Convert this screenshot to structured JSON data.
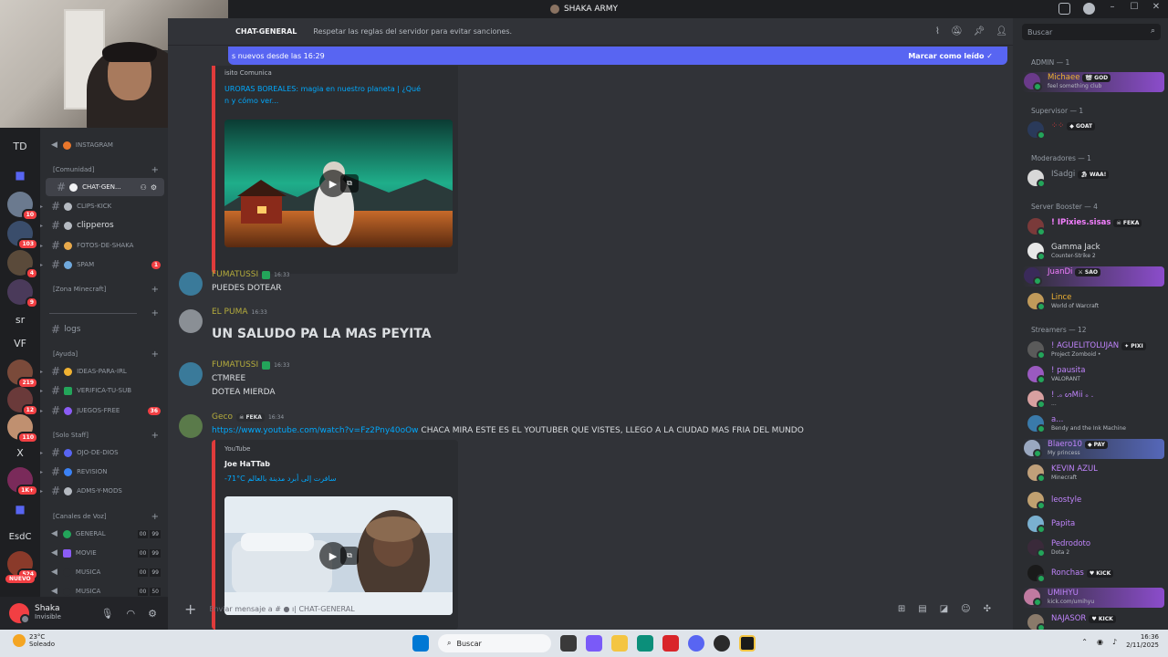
{
  "window": {
    "title": "SHAKA ARMY"
  },
  "guilds": {
    "items": [
      {
        "label": "TD",
        "badge": ""
      },
      {
        "label": "",
        "badge": ""
      },
      {
        "label": "",
        "badge": "10"
      },
      {
        "label": "",
        "badge": "103"
      },
      {
        "label": "",
        "badge": "4"
      },
      {
        "label": "",
        "badge": "9"
      },
      {
        "label": "sr",
        "badge": ""
      },
      {
        "label": "VF",
        "badge": ""
      },
      {
        "label": "",
        "badge": "219"
      },
      {
        "label": "",
        "badge": "12"
      },
      {
        "label": "",
        "badge": "110"
      },
      {
        "label": "X",
        "badge": ""
      },
      {
        "label": "",
        "badge": "1K+"
      },
      {
        "label": "",
        "badge": ""
      },
      {
        "label": "EsdC",
        "badge": ""
      },
      {
        "label": "",
        "badge": "524"
      }
    ],
    "nuevo": "NUEVO"
  },
  "channels": {
    "instagram": "INSTAGRAM",
    "cat_comunidad": "[Comunidad]",
    "chat_general": "CHAT-GEN...",
    "clips_kick": "CLIPS-KICK",
    "clipperos": "clipperos",
    "fotos": "FOTOS-DE-SHAKA",
    "spam": "SPAM",
    "spam_badge": "1",
    "cat_minecraft": "[Zona Minecraft]",
    "logs": "logs",
    "cat_ayuda": "[Ayuda]",
    "ideas": "IDEAS-PARA-IRL",
    "verifica": "VERIFICA-TU-SUB",
    "juegos": "JUEGOS-FREE",
    "juegos_badge": "36",
    "cat_staff": "[Solo Staff]",
    "ojo": "OJO-DE-DIOS",
    "revision": "REVISION",
    "adms": "ADMS-Y-MODS",
    "cat_voz": "[Canales de Voz]",
    "voice": [
      {
        "name": "GENERAL",
        "a": "00",
        "b": "99"
      },
      {
        "name": "MOVIE",
        "a": "00",
        "b": "99"
      },
      {
        "name": "MUSICA",
        "a": "00",
        "b": "99"
      },
      {
        "name": "MUSICA",
        "a": "00",
        "b": "50"
      }
    ]
  },
  "user": {
    "name": "Shaka",
    "status": "Invisible"
  },
  "chat": {
    "channel_name": "CHAT-GENERAL",
    "topic": "Respetar las reglas del servidor para evitar sanciones.",
    "new_bar_left": "s nuevos desde las 16:29",
    "new_bar_right": "Marcar como leído",
    "embed1": {
      "provider": "isito Comunica",
      "link_line1": "URORAS BOREALES: magia en nuestro planeta | ¿Qué",
      "link_line2": "n y cómo ver..."
    },
    "messages": [
      {
        "user": "FUMATUSSI",
        "time": "16:33",
        "lines": [
          "PUEDES DOTEAR"
        ]
      },
      {
        "user": "EL PUMA",
        "time": "16:33",
        "lines": [
          "UN SALUDO PA LA MAS PEYITA"
        ]
      },
      {
        "user": "FUMATUSSI",
        "time": "16:33",
        "lines": [
          "CTMREE",
          "DOTEA MIERDA"
        ]
      },
      {
        "user": "Geco",
        "tag": "FEKA",
        "time": "16:34",
        "link": "https://www.youtube.com/watch?v=Fz2Pny40oOw",
        "text": " CHACA MIRA ESTE ES EL YOUTUBER QUE VISTES, LLEGO A LA CIUDAD MAS FRIA DEL MUNDO"
      }
    ],
    "embed2": {
      "provider": "YouTube",
      "author": "Joe HaTTab",
      "title": "-71°C سافرت إلى أبرد مدينة بالعالم"
    },
    "composer_placeholder": "Enviar mensaje a #",
    "composer_channel": "CHAT-GENERAL"
  },
  "members": {
    "search_placeholder": "Buscar",
    "groups": [
      {
        "title": "ADMIN — 1"
      },
      {
        "title": "Supervisor — 1"
      },
      {
        "title": "Moderadores — 1"
      },
      {
        "title": "Server Booster — 4"
      },
      {
        "title": "Streamers — 12"
      }
    ],
    "list": [
      {
        "name": "Michaee",
        "tag": "GOD",
        "sub": "feel something club",
        "color": "#f0b232"
      },
      {
        "name": "",
        "tag": "GOAT",
        "sub": "",
        "color": "#e03b3b"
      },
      {
        "name": "ISadgi",
        "tag": "WAA!",
        "sub": "",
        "color": "#949ba4"
      },
      {
        "name": "! IPixies.sisas",
        "tag": "FEKA",
        "sub": "",
        "color": "#f47fff"
      },
      {
        "name": "Gamma Jack",
        "tag": "",
        "sub": "Counter-Strike 2",
        "color": "#dbdee1"
      },
      {
        "name": "JuanDi",
        "tag": "SAO",
        "sub": "",
        "color": "#f47fff"
      },
      {
        "name": "Lince",
        "tag": "",
        "sub": "World of Warcraft",
        "color": "#f0b232"
      },
      {
        "name": "! AGUELITOLUJAN",
        "tag": "PIXI",
        "sub": "Project Zomboid •",
        "color": "#c084fc"
      },
      {
        "name": "! pausita",
        "tag": "",
        "sub": "VALORANT",
        "color": "#c084fc"
      },
      {
        "name": "! .ₒ ᔕMii ₒ .",
        "tag": "",
        "sub": "...",
        "color": "#c084fc"
      },
      {
        "name": "a...",
        "tag": "",
        "sub": "Bendy and the Ink Machine",
        "color": "#c084fc"
      },
      {
        "name": "Blaero10",
        "tag": "PAY",
        "sub": "My princess",
        "color": "#c084fc"
      },
      {
        "name": "KEVIN AZUL",
        "tag": "",
        "sub": "Minecraft",
        "color": "#c084fc"
      },
      {
        "name": "leostyle",
        "tag": "",
        "sub": "",
        "color": "#c084fc"
      },
      {
        "name": "Papita",
        "tag": "",
        "sub": "",
        "color": "#c084fc"
      },
      {
        "name": "Pedrodoto",
        "tag": "",
        "sub": "Dota 2",
        "color": "#c084fc"
      },
      {
        "name": "Ronchas",
        "tag": "KICK",
        "sub": "",
        "color": "#c084fc"
      },
      {
        "name": "UMIHYU",
        "tag": "",
        "sub": "kick.com/umihyu",
        "color": "#c084fc"
      },
      {
        "name": "NAJASOR",
        "tag": "KICK",
        "sub": "",
        "color": "#c084fc"
      }
    ]
  },
  "taskbar": {
    "temp": "23°C",
    "weather": "Soleado",
    "search": "Buscar",
    "time": "16:36",
    "date": "2/11/2025"
  }
}
